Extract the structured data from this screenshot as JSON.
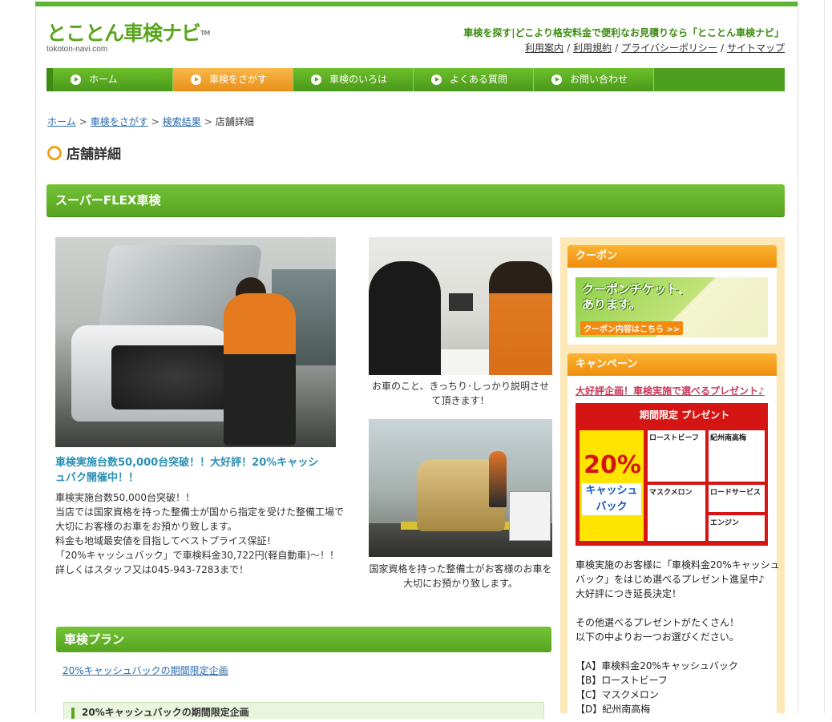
{
  "header": {
    "logo_main": "とことん車検ナビ",
    "logo_tm": "TM",
    "logo_sub": "tokoton-navi.com",
    "tagline": "車検を探す|どこより格安料金で便利なお見積りなら「とことん車検ナビ」",
    "links": [
      "利用案内",
      "利用規約",
      "プライバシーポリシー",
      "サイトマップ"
    ]
  },
  "nav": {
    "items": [
      {
        "label": "ホーム",
        "active": false
      },
      {
        "label": "車検をさがす",
        "active": true
      },
      {
        "label": "車検のいろは",
        "active": false
      },
      {
        "label": "よくある質問",
        "active": false
      },
      {
        "label": "お問い合わせ",
        "active": false
      }
    ]
  },
  "breadcrumb": {
    "links": [
      "ホーム",
      "車検をさがす",
      "検索結果"
    ],
    "current": "店舗詳細"
  },
  "page": {
    "title": "店舗詳細",
    "shop_name": "スーパーFLEX車検"
  },
  "main": {
    "headline": "車検実施台数50,000台突破！！大好評！20%キャッシュバク開催中！！",
    "description": [
      "車検実施台数50,000台突破！！",
      "当店では国家資格を持った整備士が国から指定を受けた整備工場で",
      "大切にお客様のお車をお預かり致します。",
      "料金も地域最安値を目指してベストプライス保証！",
      "「20%キャッシュバック」で車検料金30,722円(軽自動車)～！！",
      "詳しくはスタッフ又は045-943-7283まで！"
    ],
    "caption1": "お車のこと、きっちり･しっかり説明させて頂きます！",
    "caption2": "国家資格を持った整備士がお客様のお車を大切にお預かり致します。"
  },
  "plan": {
    "title": "車検プラン",
    "link": "20%キャッシュバックの期間限定企画",
    "sub_title": "20%キャッシュバックの期間限定企画"
  },
  "sidebar": {
    "coupon_title": "クーポン",
    "coupon_text_1": "クーポンチケット、",
    "coupon_text_2": "あります。",
    "coupon_button": "クーポン内容はこちら >>",
    "campaign_title": "キャンペーン",
    "campaign_link": "大好評企画！車検実施で選べるプレゼント♪",
    "banner": {
      "title": "期間限定 プレゼント",
      "pct": "20%",
      "cash": "キャッシュバック",
      "cells": [
        "ローストビーフ",
        "紀州南高梅",
        "マスクメロン",
        "ロードサービス",
        "エンジン"
      ]
    },
    "campaign_body": [
      "車検実施のお客様に「車検料金20%キャッシュ",
      "バック」をはじめ選べるプレゼント進呈中♪",
      "大好評につき延長決定！",
      "",
      "その他選べるプレゼントがたくさん！",
      "以下の中よりお一つお選びください。",
      "",
      "【A】車検料金20%キャッシュバック",
      "【B】ローストビーフ",
      "【C】マスクメロン",
      "【D】紀州南高梅"
    ]
  },
  "colors": {
    "brand_green": "#5aa61f",
    "nav_active": "#f0a11c",
    "link_blue": "#2a6ab0",
    "headline_blue": "#2a8fb5",
    "campaign_pink": "#c63a5a",
    "sidebar_bg": "#fde9b8"
  }
}
